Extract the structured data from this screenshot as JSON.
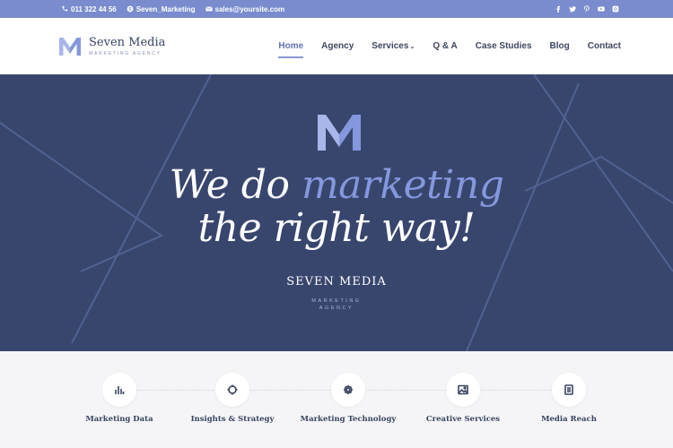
{
  "topbar": {
    "phone": "011 322 44 56",
    "skype": "Seven_Marketing",
    "email": "sales@yoursite.com",
    "socials": [
      "facebook-icon",
      "twitter-icon",
      "pinterest-icon",
      "youtube-icon",
      "instagram-icon"
    ]
  },
  "header": {
    "brand": "Seven Media",
    "tagline": "MARKETING AGENCY",
    "nav": [
      {
        "label": "Home",
        "active": true
      },
      {
        "label": "Agency"
      },
      {
        "label": "Services",
        "has_dropdown": true
      },
      {
        "label": "Q & A"
      },
      {
        "label": "Case Studies"
      },
      {
        "label": "Blog"
      },
      {
        "label": "Contact"
      }
    ]
  },
  "hero": {
    "line1_plain": "We do",
    "line1_accent": "marketing",
    "line2": "the right way!",
    "brand_name": "SEVEN MEDIA",
    "brand_tag_1": "MARKETING",
    "brand_tag_2": "AGENCY"
  },
  "services": [
    {
      "label": "Marketing Data",
      "icon": "bar-chart-icon"
    },
    {
      "label": "Insights & Strategy",
      "icon": "crosshair-icon"
    },
    {
      "label": "Marketing Technology",
      "icon": "gear-icon"
    },
    {
      "label": "Creative Services",
      "icon": "image-icon"
    },
    {
      "label": "Media Reach",
      "icon": "document-icon"
    }
  ],
  "colors": {
    "topbar": "#7a8ccd",
    "hero_bg": "#38466e",
    "accent": "#8597dd",
    "nav_active": "#6273b6"
  }
}
